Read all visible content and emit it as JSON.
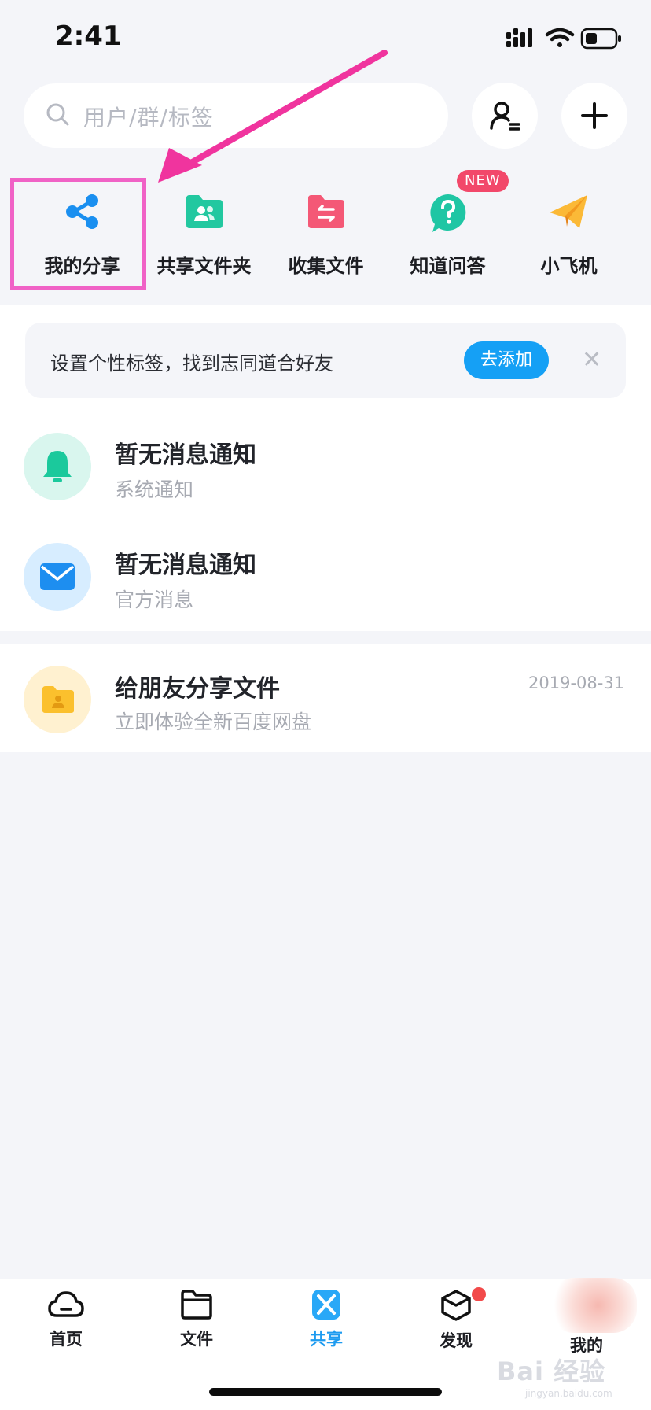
{
  "status_bar": {
    "time": "2:41"
  },
  "search": {
    "placeholder": "用户/群/标签"
  },
  "quick_actions": [
    {
      "label": "我的分享",
      "icon": "share-icon"
    },
    {
      "label": "共享文件夹",
      "icon": "shared-folder-icon"
    },
    {
      "label": "收集文件",
      "icon": "collect-folder-icon"
    },
    {
      "label": "知道问答",
      "icon": "question-bubble-icon"
    },
    {
      "label": "小飞机",
      "icon": "paper-plane-icon"
    }
  ],
  "new_badge": "NEW",
  "banner": {
    "text": "设置个性标签，找到志同道合好友",
    "button": "去添加"
  },
  "messages": [
    {
      "title": "暂无消息通知",
      "subtitle": "系统通知",
      "icon": "bell-icon"
    },
    {
      "title": "暂无消息通知",
      "subtitle": "官方消息",
      "icon": "mail-icon"
    },
    {
      "title": "给朋友分享文件",
      "subtitle": "立即体验全新百度网盘",
      "date": "2019-08-31",
      "icon": "user-folder-icon"
    }
  ],
  "tabs": [
    {
      "label": "首页",
      "icon": "cloud-icon"
    },
    {
      "label": "文件",
      "icon": "folder-icon"
    },
    {
      "label": "共享",
      "icon": "share-tab-icon",
      "active": true
    },
    {
      "label": "发现",
      "icon": "cube-icon",
      "badge_dot": true
    },
    {
      "label": "我的",
      "icon": "avatar-icon"
    }
  ],
  "watermark": {
    "text": "Bai 经验",
    "url": "jingyan.baidu.com"
  },
  "colors": {
    "accent_blue": "#1d9bf0",
    "annotation_pink": "#f062c6",
    "badge_red": "#f2486a",
    "background": "#f4f5f9"
  }
}
